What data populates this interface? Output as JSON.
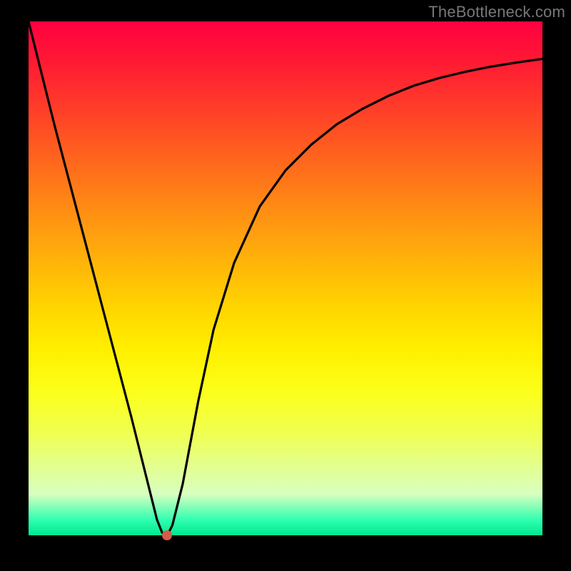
{
  "watermark": "TheBottleneck.com",
  "chart_data": {
    "type": "line",
    "title": "",
    "xlabel": "",
    "ylabel": "",
    "xlim": [
      0,
      100
    ],
    "ylim": [
      0,
      100
    ],
    "x": [
      0,
      5,
      10,
      15,
      20,
      23,
      25,
      26,
      27,
      28,
      30,
      33,
      36,
      40,
      45,
      50,
      55,
      60,
      65,
      70,
      75,
      80,
      85,
      90,
      95,
      100
    ],
    "values": [
      100,
      80,
      61,
      42,
      23,
      11,
      3,
      0.5,
      0,
      2,
      10,
      26,
      40,
      53,
      64,
      71,
      76,
      80,
      83,
      85.5,
      87.5,
      89,
      90.2,
      91.2,
      92,
      92.7
    ],
    "marker_point": {
      "x": 27,
      "y": 0
    },
    "background_gradient": {
      "top_color": "#ff0040",
      "bottom_color": "#00e890"
    }
  }
}
